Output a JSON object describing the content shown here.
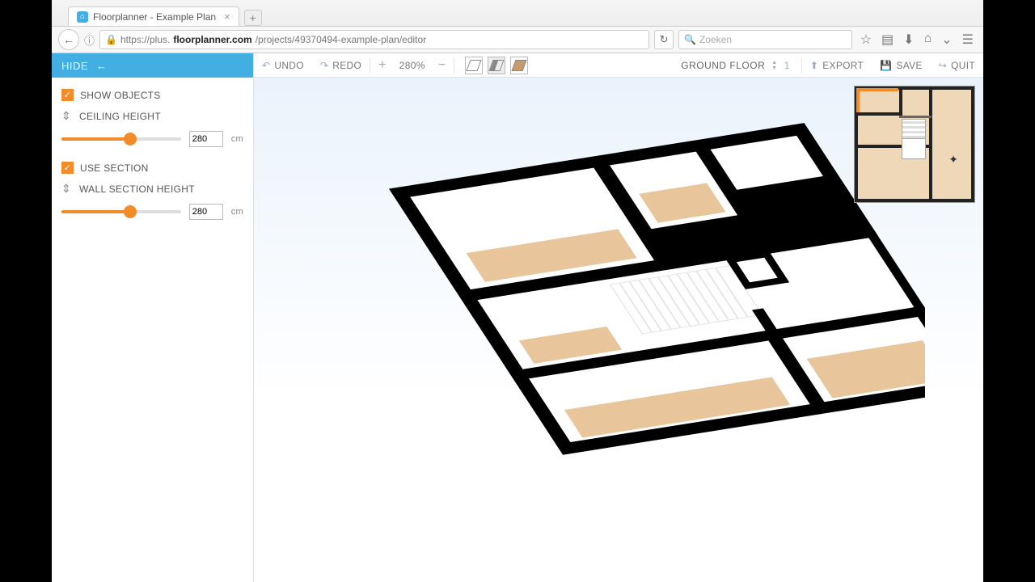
{
  "browser": {
    "tab_title": "Floorplanner - Example Plan",
    "url_prefix": "https://plus.",
    "url_bold": "floorplanner.com",
    "url_suffix": "/projects/49370494-example-plan/editor",
    "search_placeholder": "Zoeken"
  },
  "sidebar": {
    "hide_label": "HIDE",
    "show_objects": "SHOW OBJECTS",
    "ceiling_height": "CEILING HEIGHT",
    "ceiling_value": "280",
    "ceiling_unit": "cm",
    "use_section": "USE SECTION",
    "wall_section": "WALL SECTION HEIGHT",
    "wall_value": "280",
    "wall_unit": "cm"
  },
  "toolbar": {
    "undo": "UNDO",
    "redo": "REDO",
    "zoom": "280%",
    "floor_name": "GROUND FLOOR",
    "floor_num": "1",
    "export": "EXPORT",
    "save": "SAVE",
    "quit": "QUIT"
  }
}
